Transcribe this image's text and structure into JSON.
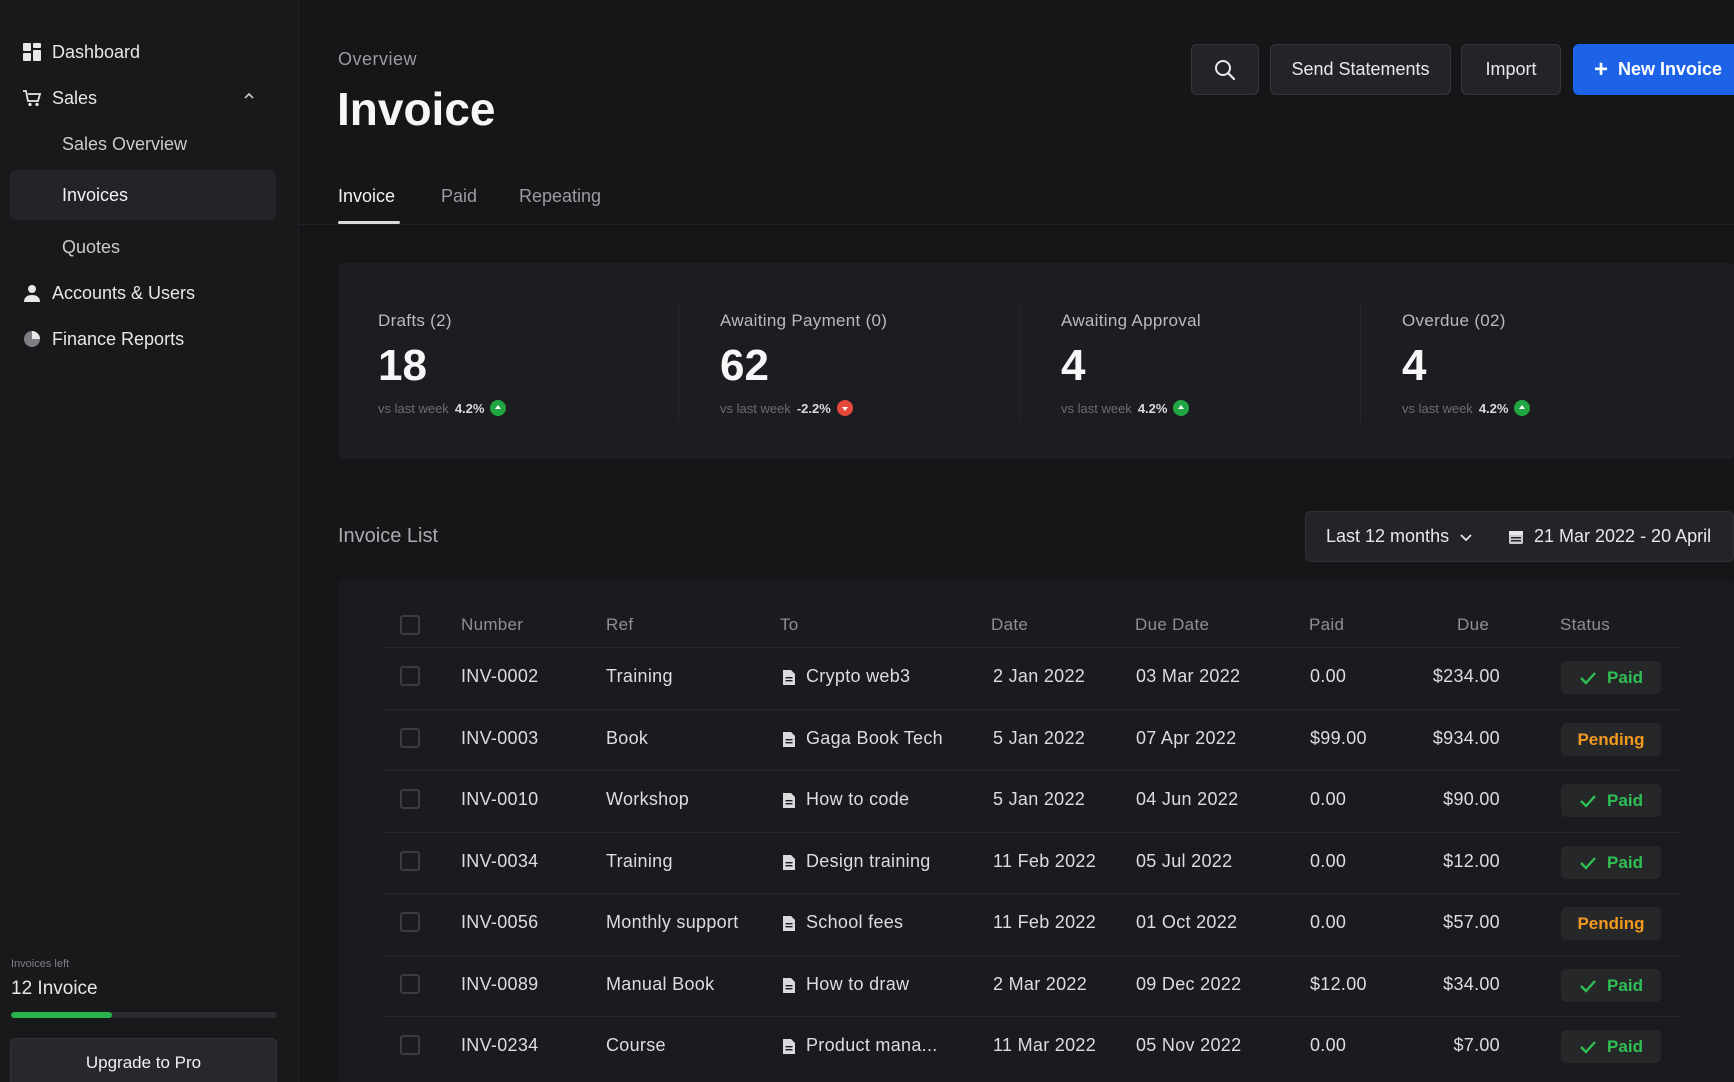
{
  "sidebar": {
    "items": [
      {
        "label": "Dashboard",
        "icon": "grid-icon"
      },
      {
        "label": "Sales",
        "icon": "cart-icon"
      },
      {
        "label": "Sales Overview"
      },
      {
        "label": "Invoices"
      },
      {
        "label": "Quotes"
      },
      {
        "label": "Accounts & Users",
        "icon": "user-icon"
      },
      {
        "label": "Finance Reports",
        "icon": "pie-chart-icon"
      }
    ],
    "usage": {
      "small_label": "Invoices left",
      "count_label": "12 Invoice",
      "progress": 0.38
    },
    "upgrade_label": "Upgrade to Pro"
  },
  "header": {
    "breadcrumb": "Overview",
    "title": "Invoice",
    "send_label": "Send Statements",
    "import_label": "Import",
    "new_plus": "+",
    "new_label": "New Invoice",
    "accent": "#1c63e8"
  },
  "tabs": [
    {
      "label": "Invoice"
    },
    {
      "label": "Paid"
    },
    {
      "label": "Repeating"
    }
  ],
  "stats": [
    {
      "label": "Drafts (2)",
      "value": "18",
      "vs": "vs last week",
      "pct": "4.2%",
      "trend": "up"
    },
    {
      "label": "Awaiting Payment (0)",
      "value": "62",
      "vs": "vs last week",
      "pct": "-2.2%",
      "trend": "down"
    },
    {
      "label": "Awaiting Approval",
      "value": "4",
      "vs": "vs last week",
      "pct": "4.2%",
      "trend": "up"
    },
    {
      "label": "Overdue (02)",
      "value": "4",
      "vs": "vs last week",
      "pct": "4.2%",
      "trend": "up"
    }
  ],
  "invoice_list": {
    "title": "Invoice List",
    "period": "Last 12 months",
    "date_range": "21 Mar 2022 - 20 April",
    "columns": [
      "Number",
      "Ref",
      "To",
      "Date",
      "Due Date",
      "Paid",
      "Due",
      "Status"
    ],
    "rows": [
      {
        "number": "INV-0002",
        "ref": "Training",
        "to": "Crypto web3",
        "date": "2 Jan 2022",
        "due_date": "03 Mar 2022",
        "paid": "0.00",
        "due": "$234.00",
        "status": "Paid"
      },
      {
        "number": "INV-0003",
        "ref": "Book",
        "to": "Gaga Book Tech",
        "date": "5 Jan 2022",
        "due_date": "07 Apr 2022",
        "paid": "$99.00",
        "due": "$934.00",
        "status": "Pending"
      },
      {
        "number": "INV-0010",
        "ref": "Workshop",
        "to": "How to code",
        "date": "5 Jan 2022",
        "due_date": "04 Jun 2022",
        "paid": "0.00",
        "due": "$90.00",
        "status": "Paid"
      },
      {
        "number": "INV-0034",
        "ref": "Training",
        "to": "Design training",
        "date": "11 Feb 2022",
        "due_date": "05 Jul 2022",
        "paid": "0.00",
        "due": "$12.00",
        "status": "Paid"
      },
      {
        "number": "INV-0056",
        "ref": "Monthly support",
        "to": "School fees",
        "date": "11 Feb 2022",
        "due_date": "01 Oct 2022",
        "paid": "0.00",
        "due": "$57.00",
        "status": "Pending"
      },
      {
        "number": "INV-0089",
        "ref": "Manual Book",
        "to": "How to draw",
        "date": "2 Mar 2022",
        "due_date": "09 Dec 2022",
        "paid": "$12.00",
        "due": "$34.00",
        "status": "Paid"
      },
      {
        "number": "INV-0234",
        "ref": "Course",
        "to": "Product mana...",
        "date": "11 Mar 2022",
        "due_date": "05 Nov 2022",
        "paid": "0.00",
        "due": "$7.00",
        "status": "Paid"
      }
    ]
  },
  "colors": {
    "paid": "#2fbf55",
    "pending": "#f29a1f",
    "up": "#21a644",
    "down": "#e5483b"
  }
}
